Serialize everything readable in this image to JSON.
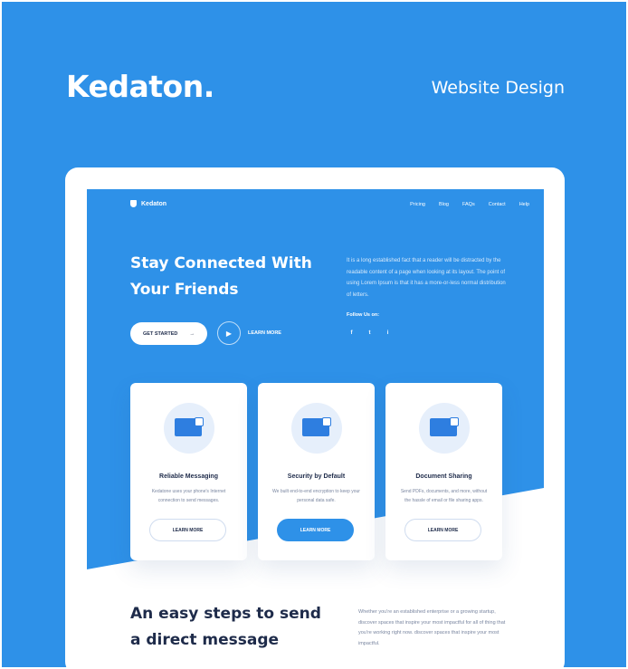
{
  "header": {
    "brand": "Kedaton.",
    "tagline": "Website Design"
  },
  "nav": {
    "logo": "Kedaton",
    "links": [
      "Pricing",
      "Blog",
      "FAQs",
      "Contact",
      "Help"
    ]
  },
  "hero": {
    "title": "Stay Connected With Your Friends",
    "description": "It is a long established fact that a reader will be distracted by the readable content of a page when looking at its layout. The point of using Lorem Ipsum is that it has a more-or-less normal distribution of letters.",
    "primary_button": "GET STARTED",
    "primary_arrow": "→",
    "secondary_button": "LEARN MORE",
    "follow_label": "Follow Us on:",
    "socials": [
      "f",
      "t",
      "i"
    ]
  },
  "cards": [
    {
      "title": "Reliable Messaging",
      "description": "Kedatone uses your phone's Internet connection to send messages.",
      "button": "LEARN MORE",
      "icon": "credit-card-icon"
    },
    {
      "title": "Security by Default",
      "description": "We built end-to-end encryption to keep your personal data safe.",
      "button": "LEARN MORE",
      "icon": "chart-card-icon"
    },
    {
      "title": "Document Sharing",
      "description": "Send PDFs, documents, and more, without the hassle of email or file sharing apps.",
      "button": "LEARN MORE",
      "icon": "document-icon"
    }
  ],
  "steps": {
    "title": "An easy steps to send a direct message",
    "description": "Whether you're an established enterprise or a growing startup, discover spaces that inspire your most impactful for all of thing that you're working right now. discover spaces that inspire your most impactful."
  },
  "colors": {
    "primary": "#2e91e8",
    "dark": "#1e2b4a",
    "muted": "#7a86a0"
  }
}
